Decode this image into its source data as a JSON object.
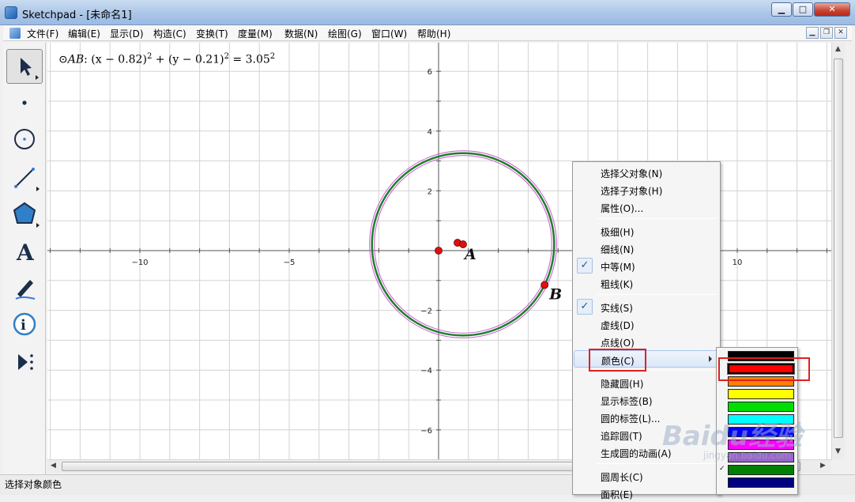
{
  "window": {
    "title": "Sketchpad  - [未命名1]",
    "min_label": "▁",
    "max_label": "□",
    "close_label": "✕"
  },
  "menu": [
    "文件(F)",
    "编辑(E)",
    "显示(D)",
    "构造(C)",
    "变换(T)",
    "度量(M)",
    "数据(N)",
    "绘图(G)",
    "窗口(W)",
    "帮助(H)"
  ],
  "tools": [
    {
      "name": "arrow-select-tool",
      "selected": true
    },
    {
      "name": "point-tool",
      "selected": false
    },
    {
      "name": "compass-tool",
      "selected": false
    },
    {
      "name": "straightedge-tool",
      "selected": false
    },
    {
      "name": "polygon-tool",
      "selected": false
    },
    {
      "name": "text-tool",
      "selected": false
    },
    {
      "name": "marker-tool",
      "selected": false
    },
    {
      "name": "information-tool",
      "selected": false
    },
    {
      "name": "custom-tool",
      "selected": false
    }
  ],
  "equation": {
    "symbol": "⊙",
    "name": "AB",
    "part1": ": (x − 0.82)",
    "sup1": "2",
    "part2": " + (y − 0.21)",
    "sup2": "2",
    "part3": " = 3.05",
    "sup3": "2"
  },
  "graph": {
    "x_ticks": [
      "−10",
      "−5",
      "10"
    ],
    "y_ticks": [
      "6",
      "4",
      "2",
      "−2",
      "−4",
      "−6"
    ],
    "circle": {
      "cx": 0.82,
      "cy": 0.21,
      "r": 3.05
    },
    "points": {
      "A": "A",
      "B": "B"
    },
    "colors": {
      "circle": "#1e7f2e",
      "highlight": "#d055d0",
      "point": "#e01010"
    }
  },
  "context_menu": {
    "items": [
      {
        "label": "选择父对象(N)",
        "checked": false
      },
      {
        "label": "选择子对象(H)",
        "checked": false
      },
      {
        "label": "属性(O)...",
        "checked": false
      },
      {
        "sep": true
      },
      {
        "label": "极细(H)",
        "checked": false
      },
      {
        "label": "细线(N)",
        "checked": false
      },
      {
        "label": "中等(M)",
        "checked": true
      },
      {
        "label": "粗线(K)",
        "checked": false
      },
      {
        "sep": true
      },
      {
        "label": "实线(S)",
        "checked": true
      },
      {
        "label": "虚线(D)",
        "checked": false
      },
      {
        "label": "点线(O)",
        "checked": false
      },
      {
        "label": "颜色(C)",
        "checked": false,
        "submenu": true,
        "hover": true
      },
      {
        "sep": true
      },
      {
        "label": "隐藏圆(H)",
        "checked": false
      },
      {
        "label": "显示标签(B)",
        "checked": false
      },
      {
        "label": "圆的标签(L)...",
        "checked": false
      },
      {
        "label": "追踪圆(T)",
        "checked": false
      },
      {
        "label": "生成圆的动画(A)",
        "checked": false
      },
      {
        "sep": true
      },
      {
        "label": "圆周长(C)",
        "checked": false
      },
      {
        "label": "面积(E)",
        "checked": false
      }
    ]
  },
  "color_palette": {
    "colors": [
      "#000000",
      "#ff0000",
      "#ff8000",
      "#ffff00",
      "#00dd00",
      "#00ffff",
      "#0000ff",
      "#ff00ff",
      "#9966cc",
      "#008000",
      "#000080"
    ],
    "selected_index": 1,
    "checked_index": 9
  },
  "status": "选择对象颜色",
  "watermark": {
    "main": "Baidu经验",
    "sub": "jingyan.baidu.com"
  }
}
